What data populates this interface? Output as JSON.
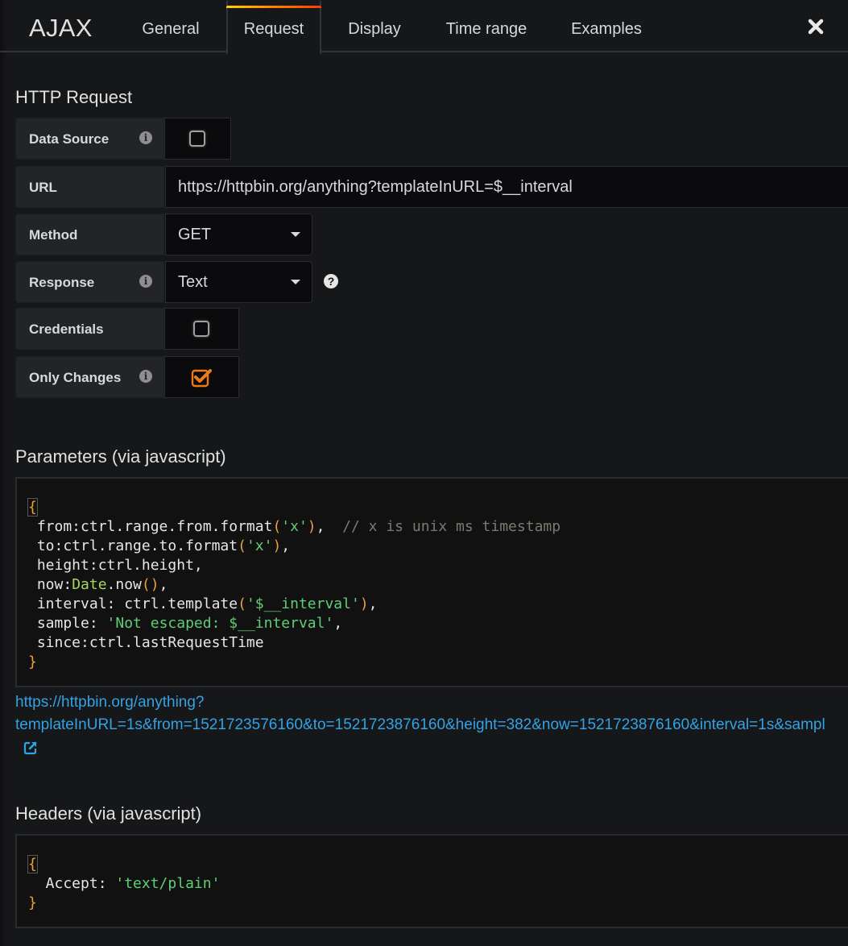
{
  "header": {
    "app_title": "AJAX",
    "tabs": [
      {
        "label": "General",
        "active": false
      },
      {
        "label": "Request",
        "active": true
      },
      {
        "label": "Display",
        "active": false
      },
      {
        "label": "Time range",
        "active": false
      },
      {
        "label": "Examples",
        "active": false
      }
    ],
    "close_icon": "close-icon",
    "active_tab_gradient": [
      "#ffd500",
      "#ff7300",
      "#f53e0a"
    ]
  },
  "http_request": {
    "title": "HTTP Request",
    "data_source": {
      "label": "Data Source",
      "checked": false,
      "info_icon": "info-icon"
    },
    "url": {
      "label": "URL",
      "value": "https://httpbin.org/anything?templateInURL=$__interval"
    },
    "method": {
      "label": "Method",
      "value": "GET"
    },
    "response": {
      "label": "Response",
      "value": "Text",
      "info_icon": "info-icon",
      "help_icon": "question-circle-icon"
    },
    "credentials": {
      "label": "Credentials",
      "checked": false
    },
    "only_changes": {
      "label": "Only Changes",
      "checked": true,
      "info_icon": "info-icon",
      "checkbox_color": "#eb7b18"
    }
  },
  "parameters": {
    "title": "Parameters (via javascript)",
    "code_lines": [
      "{",
      " from:ctrl.range.from.format('x'),  // x is unix ms timestamp",
      " to:ctrl.range.to.format('x'),",
      " height:ctrl.height,",
      " now:Date.now(),",
      " interval: ctrl.template('$__interval'),",
      " sample: 'Not escaped: $__interval',",
      " since:ctrl.lastRequestTime",
      "}"
    ],
    "tokens": {
      "l1_a": " from:ctrl.range.from.format",
      "l1_p1": "(",
      "l1_s": "'x'",
      "l1_p2": ")",
      "l1_b": ",  ",
      "l1_c": "// x is unix ms timestamp",
      "l2_a": " to:ctrl.range.to.format",
      "l2_p1": "(",
      "l2_s": "'x'",
      "l2_p2": ")",
      "l2_b": ",",
      "l3": " height:ctrl.height,",
      "l4_a": " now:",
      "l4_f": "Date",
      "l4_b": ".now",
      "l4_p": "()",
      "l4_c": ",",
      "l5_a": " interval: ctrl.template",
      "l5_p1": "(",
      "l5_s": "'$__interval'",
      "l5_p2": ")",
      "l5_b": ",",
      "l6_a": " sample: ",
      "l6_s": "'Not escaped: $__interval'",
      "l6_b": ",",
      "l7": " since:ctrl.lastRequestTime",
      "open": "{",
      "close": "}"
    },
    "resolved_url_line1": "https://httpbin.org/anything?",
    "resolved_url_line2": "templateInURL=1s&from=1521723576160&to=1521723876160&height=382&now=1521723876160&interval=1s&sampl",
    "external_link_icon": "external-link-icon",
    "link_color": "#33a2e5"
  },
  "headers": {
    "title": "Headers (via javascript)",
    "code_lines": [
      "{",
      "  Accept: 'text/plain'",
      "}"
    ],
    "tokens": {
      "open": "{",
      "key": "  Accept: ",
      "value": "'text/plain'",
      "close": "}"
    }
  }
}
